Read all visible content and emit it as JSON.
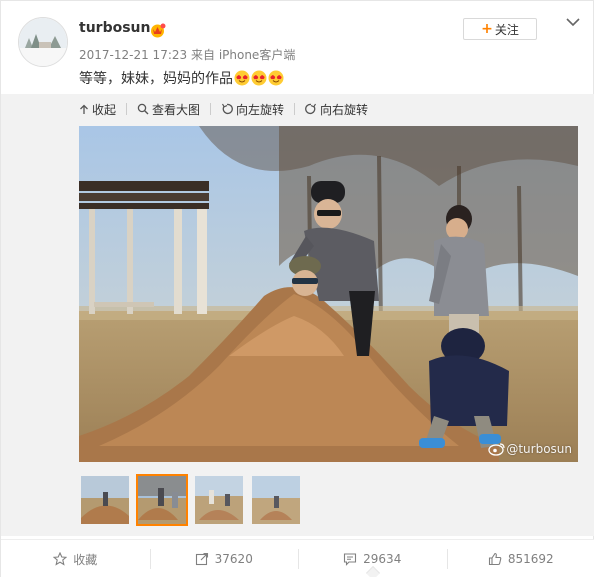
{
  "post": {
    "username": "turbosun",
    "timestamp": "2017-12-21 17:23",
    "source_prefix": "来自",
    "source": "iPhone客户端",
    "text": "等等，妹妹，妈妈的作品",
    "emoji_icons": [
      "heart-eyes-emoji",
      "heart-eyes-emoji",
      "heart-eyes-emoji"
    ]
  },
  "header": {
    "follow_label": "关注",
    "menu_icon": "chevron-down-icon",
    "badge_icon": "crown-badge-icon"
  },
  "media_toolbar": {
    "collapse_label": "收起",
    "view_large_label": "查看大图",
    "rotate_left_label": "向左旋转",
    "rotate_right_label": "向右旋转"
  },
  "photo": {
    "watermark": "@turbosun",
    "thumbnail_count": 4,
    "active_thumbnail": 2
  },
  "actions": {
    "favorite_label": "收藏",
    "repost_count": "37620",
    "comment_count": "29634",
    "like_count": "851692"
  },
  "colors": {
    "accent": "#ff8200",
    "panel_bg": "#f2f2f2",
    "meta_text": "#808080"
  }
}
